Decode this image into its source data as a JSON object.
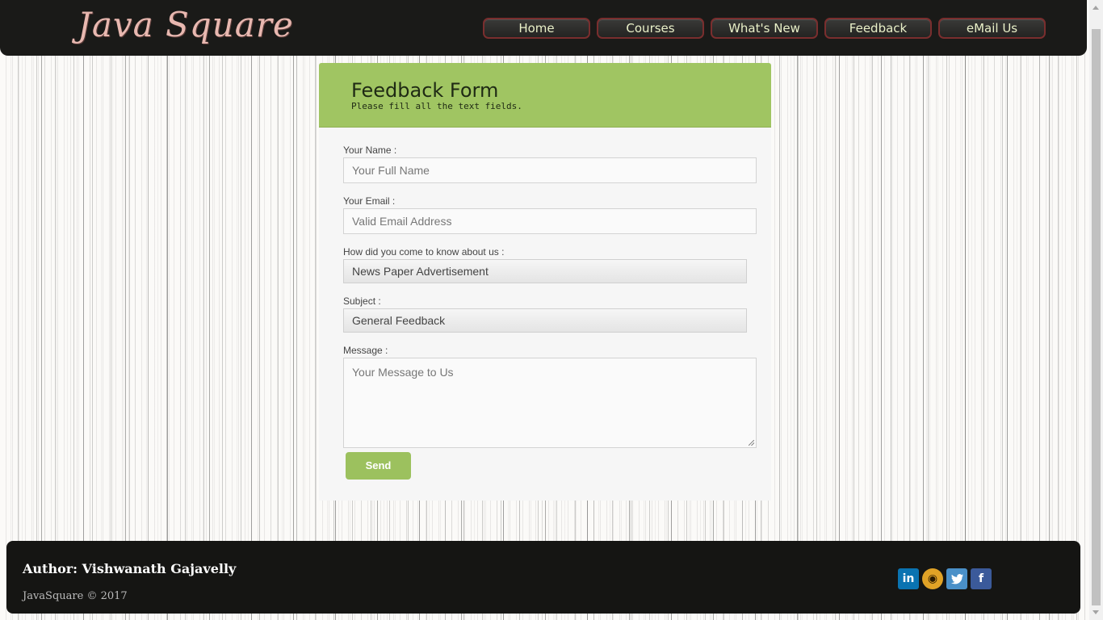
{
  "header": {
    "logo_text": "Java Square",
    "nav": [
      "Home",
      "Courses",
      "What's New",
      "Feedback",
      "eMail Us"
    ]
  },
  "form": {
    "title": "Feedback Form",
    "subtitle": "Please fill all the text fields.",
    "name_label": "Your Name :",
    "name_placeholder": "Your Full Name",
    "email_label": "Your Email :",
    "email_placeholder": "Valid Email Address",
    "source_label": "How did you come to know about us :",
    "source_value": "News Paper Advertisement",
    "subject_label": "Subject :",
    "subject_value": "General Feedback",
    "message_label": "Message :",
    "message_placeholder": "Your Message to Us",
    "send_label": "Send"
  },
  "footer": {
    "author": "Author: Vishwanath Gajavelly",
    "copyright": "JavaSquare © 2017",
    "social_icons": [
      "linkedin-icon",
      "github-icon",
      "twitter-icon",
      "facebook-icon"
    ]
  },
  "colors": {
    "header_bg": "#1a1a18",
    "accent_green": "#a0c562",
    "nav_text": "#e9f0c8",
    "logo": "#e8b8b0"
  }
}
